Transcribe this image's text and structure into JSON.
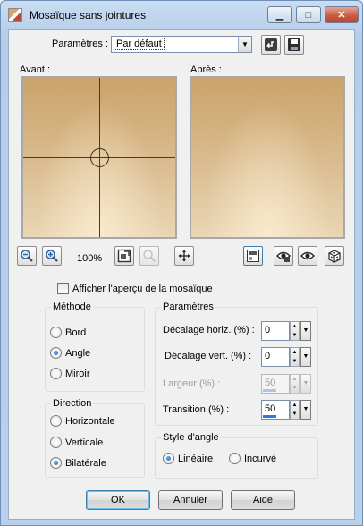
{
  "window": {
    "title": "Mosaïque sans jointures"
  },
  "title_buttons": {
    "minimize": "▁",
    "maximize": "□",
    "close": "✕"
  },
  "presets": {
    "label": "Paramètres :",
    "selected": "Par défaut"
  },
  "previews": {
    "before_label": "Avant :",
    "after_label": "Après :"
  },
  "zoom": {
    "level": "100%"
  },
  "tile_preview_checkbox": {
    "label": "Afficher l'aperçu de la mosaïque",
    "checked": false
  },
  "method": {
    "title": "Méthode",
    "options": [
      {
        "label": "Bord",
        "checked": false
      },
      {
        "label": "Angle",
        "checked": true
      },
      {
        "label": "Miroir",
        "checked": false
      }
    ]
  },
  "direction": {
    "title": "Direction",
    "options": [
      {
        "label": "Horizontale",
        "checked": false
      },
      {
        "label": "Verticale",
        "checked": false
      },
      {
        "label": "Bilatérale",
        "checked": true
      }
    ]
  },
  "settings": {
    "title": "Paramètres",
    "fields": [
      {
        "label": "Décalage horiz. (%) :",
        "value": "0",
        "enabled": true
      },
      {
        "label": "Décalage vert. (%) :",
        "value": "0",
        "enabled": true
      },
      {
        "label": "Largeur (%) :",
        "value": "50",
        "enabled": false
      },
      {
        "label": "Transition (%) :",
        "value": "50",
        "enabled": true
      }
    ]
  },
  "corner_style": {
    "title": "Style d'angle",
    "options": [
      {
        "label": "Linéaire",
        "checked": true
      },
      {
        "label": "Incurvé",
        "checked": false
      }
    ]
  },
  "buttons": {
    "ok": "OK",
    "cancel": "Annuler",
    "help": "Aide"
  },
  "colors": {
    "accent": "#2c7be5",
    "preview_dark": "#cba36a",
    "preview_light": "#e9d6b4"
  }
}
